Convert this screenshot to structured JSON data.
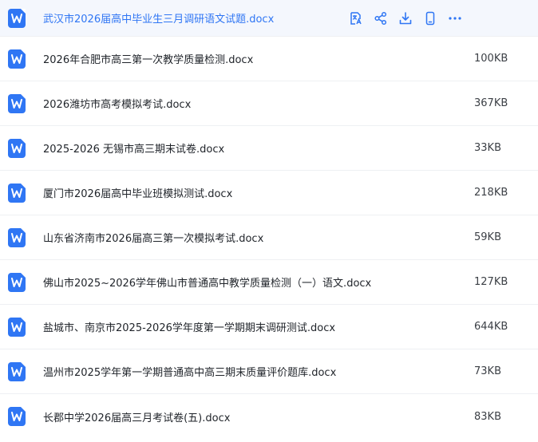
{
  "files": [
    {
      "name": "武汉市2026届高中毕业生三月调研语文试题.docx",
      "size": ""
    },
    {
      "name": "2026年合肥市高三第一次教学质量检测.docx",
      "size": "100KB"
    },
    {
      "name": "2026潍坊市高考模拟考试.docx",
      "size": "367KB"
    },
    {
      "name": "2025-2026 无锡市高三期末试卷.docx",
      "size": "33KB"
    },
    {
      "name": "厦门市2026届高中毕业班模拟测试.docx",
      "size": "218KB"
    },
    {
      "name": "山东省济南市2026届高三第一次模拟考试.docx",
      "size": "59KB"
    },
    {
      "name": "佛山市2025~2026学年佛山市普通高中教学质量检测（一）语文.docx",
      "size": "127KB"
    },
    {
      "name": "盐城市、南京市2025-2026学年度第一学期期末调研测试.docx",
      "size": "644KB"
    },
    {
      "name": "温州市2025学年第一学期普通高中高三期末质量评价题库.docx",
      "size": "73KB"
    },
    {
      "name": "长郡中学2026届高三月考试卷(五).docx",
      "size": "83KB"
    }
  ],
  "row_actions": [
    {
      "icon": "translate-icon"
    },
    {
      "icon": "share-icon"
    },
    {
      "icon": "download-icon"
    },
    {
      "icon": "phone-icon"
    },
    {
      "icon": "more-icon"
    }
  ],
  "colors": {
    "accent": "#2f76f4",
    "active_row_bg": "#f4f7fd",
    "text": "#1f2329",
    "size_text": "#3b3f45"
  }
}
